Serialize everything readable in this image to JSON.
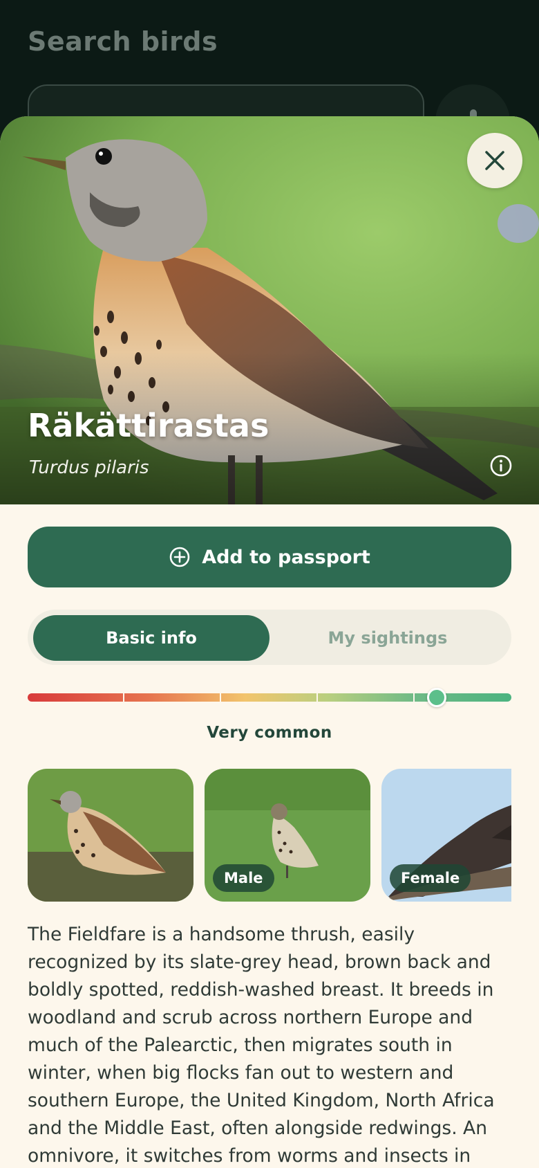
{
  "background_screen": {
    "title": "Search birds"
  },
  "sheet": {
    "close_icon": "close-icon",
    "bird": {
      "name": "Räkättirastas",
      "latin_name": "Turdus pilaris"
    },
    "info_icon": "info-circle-icon",
    "add_button": {
      "label": "Add to passport",
      "icon": "plus-circle-icon"
    },
    "tabs": [
      {
        "label": "Basic info",
        "active": true
      },
      {
        "label": "My sightings",
        "active": false
      }
    ],
    "rarity": {
      "label": "Very common",
      "level": 0.846,
      "segments": 5
    },
    "gallery": [
      {
        "badge": ""
      },
      {
        "badge": "Male"
      },
      {
        "badge": "Female"
      }
    ],
    "description": "The Fieldfare is a handsome thrush, easily recognized by its slate-grey head, brown back and boldly spotted, reddish-washed breast. It breeds in woodland and scrub across northern Europe and much of the Palearctic, then migrates south in winter, when big flocks fan out to western and southern Europe, the United Kingdom, North Africa and the Middle East, often alongside redwings. An omnivore, it switches from worms and insects in summer to"
  },
  "colors": {
    "primary": "#2e6b52",
    "sheet_background": "#fdf7ec",
    "rarity_knob": "#5cbf8b"
  }
}
